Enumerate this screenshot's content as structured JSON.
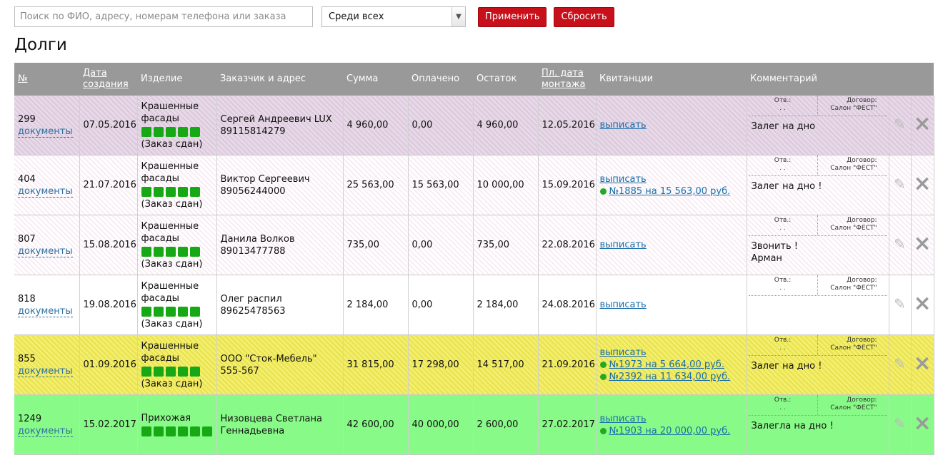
{
  "toolbar": {
    "search_placeholder": "Поиск по ФИО, адресу, номерам телефона или заказа",
    "filter_value": "Среди всех",
    "apply_label": "Применить",
    "reset_label": "Сбросить"
  },
  "page_title": "Долги",
  "columns": {
    "num": "№",
    "created_1": "Дата",
    "created_2": "создания",
    "product": "Изделие",
    "customer": "Заказчик и адрес",
    "sum": "Сумма",
    "paid": "Оплачено",
    "remain": "Остаток",
    "mount_1": "Пл. дата",
    "mount_2": "монтажа",
    "receipts": "Квитанции",
    "comment": "Комментарий"
  },
  "common": {
    "docs_label": "документы",
    "issue_label": "выписать",
    "otv_label": "Отв.:",
    "otv_value": ". .",
    "dog_label": "Договор:",
    "dog_value": "Салон \"ФЕСТ\""
  },
  "colors": {
    "accent_button": "#c8101a",
    "progress_square": "#17a815",
    "row_lilac": "#dcc9dc",
    "row_yellow": "#f3ee6e",
    "row_green": "#88fa88"
  },
  "rows": [
    {
      "num": "299",
      "date": "07.05.2016",
      "product_1": "Крашенные",
      "product_2": "фасады",
      "steps": 5,
      "status": "(Заказ сдан)",
      "cust_1": "Сергей Андреевич LUX",
      "cust_2": "89115814279",
      "sum": "4 960,00",
      "paid": "0,00",
      "remain": "4 960,00",
      "mount": "12.05.2016",
      "receipt_1": "",
      "receipt_2": "",
      "comment_1": "Залег на дно",
      "comment_2": ""
    },
    {
      "num": "404",
      "date": "21.07.2016",
      "product_1": "Крашенные",
      "product_2": "фасады",
      "steps": 5,
      "status": "(Заказ сдан)",
      "cust_1": "Виктор Сергеевич",
      "cust_2": "89056244000",
      "sum": "25 563,00",
      "paid": "15 563,00",
      "remain": "10 000,00",
      "mount": "15.09.2016",
      "receipt_1": "№1885 на 15 563,00 руб.",
      "receipt_2": "",
      "comment_1": "Залег на дно !",
      "comment_2": ""
    },
    {
      "num": "807",
      "date": "15.08.2016",
      "product_1": "Крашенные",
      "product_2": "фасады",
      "steps": 5,
      "status": "(Заказ сдан)",
      "cust_1": "Данила Волков",
      "cust_2": "89013477788",
      "sum": "735,00",
      "paid": "0,00",
      "remain": "735,00",
      "mount": "22.08.2016",
      "receipt_1": "",
      "receipt_2": "",
      "comment_1": "Звонить !",
      "comment_2": "Арман"
    },
    {
      "num": "818",
      "date": "19.08.2016",
      "product_1": "Крашенные",
      "product_2": "фасады",
      "steps": 5,
      "status": "(Заказ сдан)",
      "cust_1": "Олег распил",
      "cust_2": "89625478563",
      "sum": "2 184,00",
      "paid": "0,00",
      "remain": "2 184,00",
      "mount": "24.08.2016",
      "receipt_1": "",
      "receipt_2": "",
      "comment_1": "",
      "comment_2": ""
    },
    {
      "num": "855",
      "date": "01.09.2016",
      "product_1": "Крашенные",
      "product_2": "фасады",
      "steps": 5,
      "status": "(Заказ сдан)",
      "cust_1": "ООО \"Сток-Мебель\"",
      "cust_2": "555-567",
      "sum": "31 815,00",
      "paid": "17 298,00",
      "remain": "14 517,00",
      "mount": "21.09.2016",
      "receipt_1": "№1973 на 5 664,00 руб.",
      "receipt_2": "№2392 на 11 634,00 руб.",
      "comment_1": "Залег на дно !",
      "comment_2": ""
    },
    {
      "num": "1249",
      "date": "15.02.2017",
      "product_1": "Прихожая",
      "product_2": "",
      "steps": 6,
      "status": "",
      "cust_1": "Низовцева Светлана",
      "cust_2": "Геннадьевна",
      "sum": "42 600,00",
      "paid": "40 000,00",
      "remain": "2 600,00",
      "mount": "27.02.2017",
      "receipt_1": "№1903 на 20 000,00 руб.",
      "receipt_2": "",
      "comment_1": "Залегла на дно !",
      "comment_2": ""
    }
  ]
}
